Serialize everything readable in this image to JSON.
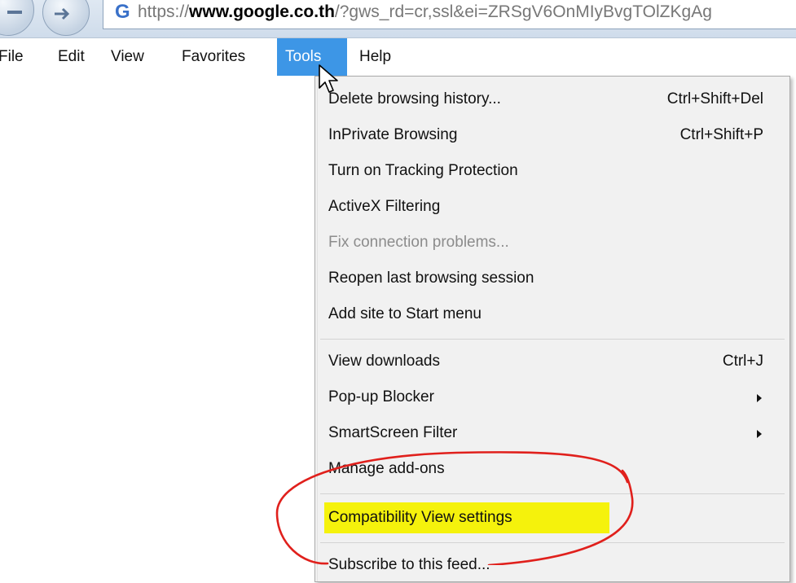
{
  "address_bar": {
    "url_scheme": "https://",
    "url_domain": "www.google.co.th",
    "url_rest": "/?gws_rd=cr,ssl&ei=ZRSgV6OnMIyBvgTOlZKgAg"
  },
  "menubar": {
    "items": [
      "File",
      "Edit",
      "View",
      "Favorites",
      "Tools",
      "Help"
    ],
    "active": "Tools"
  },
  "tools_menu": {
    "group1": [
      {
        "label": "Delete browsing history...",
        "shortcut": "Ctrl+Shift+Del"
      },
      {
        "label": "InPrivate Browsing",
        "shortcut": "Ctrl+Shift+P"
      },
      {
        "label": "Turn on Tracking Protection"
      },
      {
        "label": "ActiveX Filtering"
      },
      {
        "label": "Fix connection problems...",
        "disabled": true
      },
      {
        "label": "Reopen last browsing session"
      },
      {
        "label": "Add site to Start menu"
      }
    ],
    "group2": [
      {
        "label": "View downloads",
        "shortcut": "Ctrl+J"
      },
      {
        "label": "Pop-up Blocker",
        "submenu": true
      },
      {
        "label": "SmartScreen Filter",
        "submenu": true
      },
      {
        "label": "Manage add-ons"
      }
    ],
    "group3": [
      {
        "label": "Compatibility View settings",
        "highlighted": true
      },
      {
        "label": "Subscribe to this feed..."
      }
    ]
  },
  "colors": {
    "menu_active_bg": "#3d96e6",
    "highlight_marker": "#f5f20c",
    "annotation_circle": "#e0201c"
  }
}
